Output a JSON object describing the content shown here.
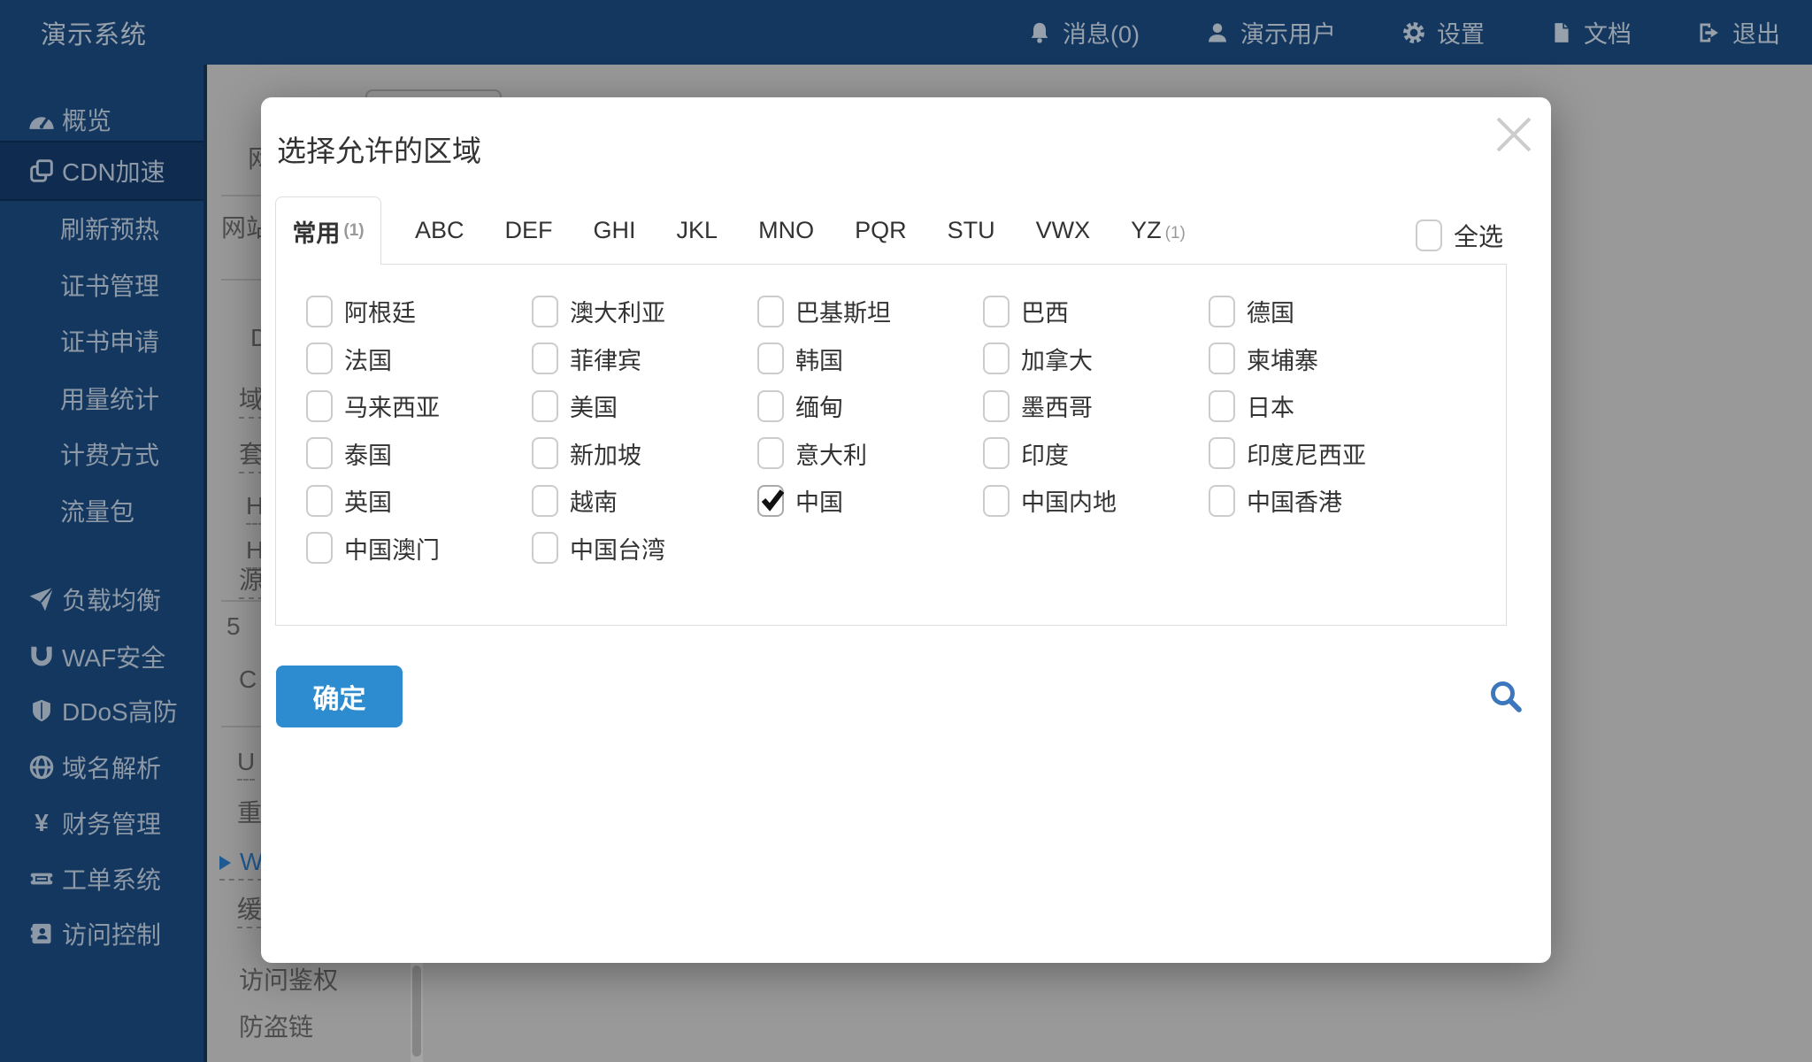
{
  "navbar": {
    "brand": "演示系统",
    "items": [
      {
        "name": "messages",
        "icon": "bell",
        "label": "消息(0)"
      },
      {
        "name": "user",
        "icon": "user",
        "label": "演示用户"
      },
      {
        "name": "settings",
        "icon": "gear",
        "label": "设置"
      },
      {
        "name": "docs",
        "icon": "document",
        "label": "文档"
      },
      {
        "name": "logout",
        "icon": "logout",
        "label": "退出"
      }
    ]
  },
  "sidebar": {
    "items": [
      {
        "name": "overview",
        "icon": "gauge",
        "label": "概览"
      },
      {
        "name": "cdn",
        "icon": "layers",
        "label": "CDN加速",
        "active": true
      },
      {
        "name": "refresh-preheat",
        "label": "刷新预热",
        "sub": true
      },
      {
        "name": "cert-manage",
        "label": "证书管理",
        "sub": true
      },
      {
        "name": "cert-apply",
        "label": "证书申请",
        "sub": true
      },
      {
        "name": "usage-stats",
        "label": "用量统计",
        "sub": true
      },
      {
        "name": "billing",
        "label": "计费方式",
        "sub": true
      },
      {
        "name": "traffic-pack",
        "label": "流量包",
        "sub": true
      },
      {
        "name": "load-balance",
        "icon": "plane",
        "label": "负载均衡"
      },
      {
        "name": "waf",
        "icon": "magnet",
        "label": "WAF安全"
      },
      {
        "name": "ddos",
        "icon": "shield",
        "label": "DDoS高防"
      },
      {
        "name": "dns",
        "icon": "globe",
        "label": "域名解析"
      },
      {
        "name": "finance",
        "icon": "yen",
        "label": "财务管理"
      },
      {
        "name": "tickets",
        "icon": "ticket",
        "label": "工单系统"
      },
      {
        "name": "access-control",
        "icon": "idcard",
        "label": "访问控制"
      }
    ]
  },
  "background": {
    "fragments": [
      {
        "text": "网"
      },
      {
        "text": "网站"
      },
      {
        "text": "D"
      },
      {
        "text": "域",
        "dashed": true
      },
      {
        "text": "套",
        "dashed": true
      },
      {
        "text": "H",
        "dashed": true
      },
      {
        "text": "H",
        "dashed": true
      },
      {
        "text": "源",
        "dashed": true
      },
      {
        "text": "5"
      },
      {
        "text": "C"
      },
      {
        "text": "U",
        "dashed": true
      },
      {
        "text": "重"
      },
      {
        "text": "W",
        "dashed": true,
        "blue": true,
        "arrow": true
      },
      {
        "text": "缓",
        "dashed": true
      },
      {
        "text": "访问鉴权"
      },
      {
        "text": "防盗链"
      }
    ]
  },
  "modal": {
    "title": "选择允许的区域",
    "tabs": [
      {
        "label": "常用",
        "count": "(1)",
        "active": true
      },
      {
        "label": "ABC"
      },
      {
        "label": "DEF"
      },
      {
        "label": "GHI"
      },
      {
        "label": "JKL"
      },
      {
        "label": "MNO"
      },
      {
        "label": "PQR"
      },
      {
        "label": "STU"
      },
      {
        "label": "VWX"
      },
      {
        "label": "YZ",
        "count": "(1)"
      }
    ],
    "select_all_label": "全选",
    "select_all_checked": false,
    "regions": [
      {
        "label": "阿根廷",
        "checked": false
      },
      {
        "label": "澳大利亚",
        "checked": false
      },
      {
        "label": "巴基斯坦",
        "checked": false
      },
      {
        "label": "巴西",
        "checked": false
      },
      {
        "label": "德国",
        "checked": false
      },
      {
        "label": "法国",
        "checked": false
      },
      {
        "label": "菲律宾",
        "checked": false
      },
      {
        "label": "韩国",
        "checked": false
      },
      {
        "label": "加拿大",
        "checked": false
      },
      {
        "label": "柬埔寨",
        "checked": false
      },
      {
        "label": "马来西亚",
        "checked": false
      },
      {
        "label": "美国",
        "checked": false
      },
      {
        "label": "缅甸",
        "checked": false
      },
      {
        "label": "墨西哥",
        "checked": false
      },
      {
        "label": "日本",
        "checked": false
      },
      {
        "label": "泰国",
        "checked": false
      },
      {
        "label": "新加坡",
        "checked": false
      },
      {
        "label": "意大利",
        "checked": false
      },
      {
        "label": "印度",
        "checked": false
      },
      {
        "label": "印度尼西亚",
        "checked": false
      },
      {
        "label": "英国",
        "checked": false
      },
      {
        "label": "越南",
        "checked": false
      },
      {
        "label": "中国",
        "checked": true
      },
      {
        "label": "中国内地",
        "checked": false
      },
      {
        "label": "中国香港",
        "checked": false
      },
      {
        "label": "中国澳门",
        "checked": false
      },
      {
        "label": "中国台湾",
        "checked": false
      }
    ],
    "confirm_label": "确定"
  },
  "colors": {
    "navbar_bg": "#14375f",
    "primary": "#2d8ccf",
    "search_icon": "#3c77bd"
  }
}
